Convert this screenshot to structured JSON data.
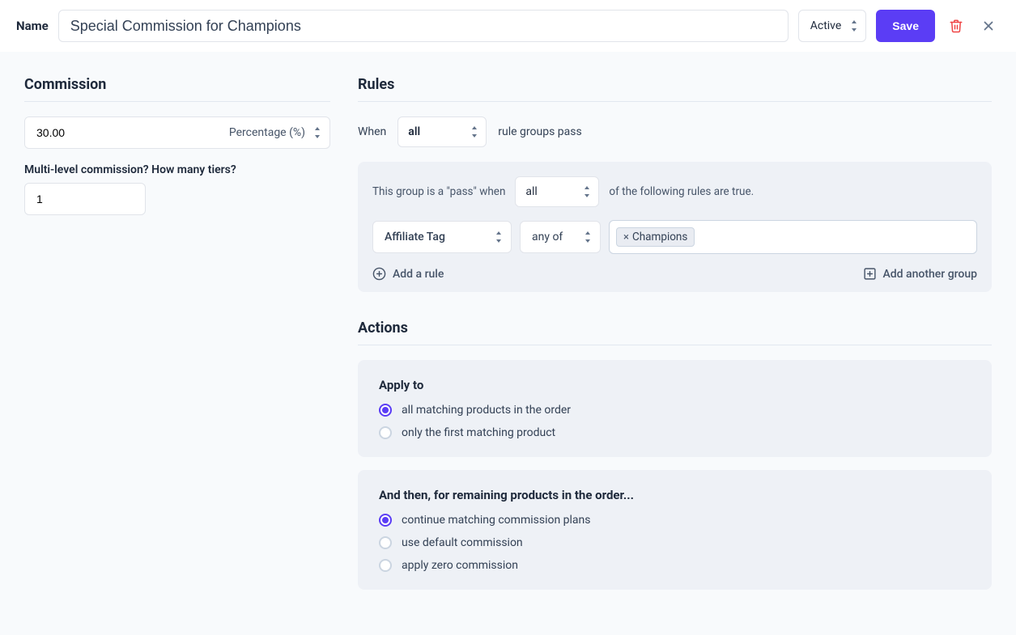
{
  "topbar": {
    "name_label": "Name",
    "name_value": "Special Commission for Champions",
    "status": "Active",
    "save_label": "Save"
  },
  "commission": {
    "title": "Commission",
    "value": "30.00",
    "type_label": "Percentage (%)",
    "tiers_label": "Multi-level commission? How many tiers?",
    "tiers_value": "1"
  },
  "rules": {
    "title": "Rules",
    "when_label": "When",
    "when_value": "all",
    "when_suffix": "rule groups pass",
    "group": {
      "prefix": "This group is a \"pass\" when",
      "mode": "all",
      "suffix": "of the following rules are true.",
      "rule": {
        "field": "Affiliate Tag",
        "operator": "any of",
        "tag": "Champions"
      },
      "add_rule_label": "Add a rule",
      "add_group_label": "Add another group"
    }
  },
  "actions": {
    "title": "Actions",
    "apply_to": {
      "heading": "Apply to",
      "options": [
        "all matching products in the order",
        "only the first matching product"
      ],
      "selected": 0
    },
    "remaining": {
      "heading": "And then, for remaining products in the order...",
      "options": [
        "continue matching commission plans",
        "use default commission",
        "apply zero commission"
      ],
      "selected": 0
    }
  }
}
